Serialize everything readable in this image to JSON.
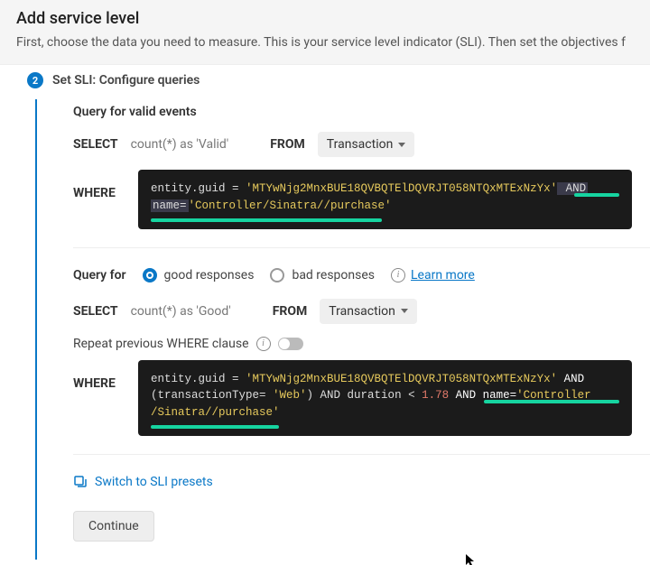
{
  "header": {
    "title": "Add service level",
    "description": "First, choose the data you need to measure. This is your service level indicator (SLI). Then set the objectives f"
  },
  "step": {
    "number": "2",
    "label": "Set SLI: Configure queries"
  },
  "valid": {
    "title": "Query for valid events",
    "select_kw": "SELECT",
    "select_expr": "count(*) as 'Valid'",
    "from_kw": "FROM",
    "source": "Transaction",
    "where_kw": "WHERE",
    "code": {
      "l1a": "entity.guid = ",
      "l1b": "'MTYwNjg2MnxBUE18QVBQTElDQVRJT058NTQxMTExNzYx'",
      "l1c": " AND ",
      "l2a": "name=",
      "l2b": "'Controller/Sinatra//purchase'"
    }
  },
  "good": {
    "title": "Query for",
    "radio_good": "good responses",
    "radio_bad": "bad responses",
    "learn_more": "Learn more",
    "select_kw": "SELECT",
    "select_expr": "count(*) as 'Good'",
    "from_kw": "FROM",
    "source": "Transaction",
    "repeat_label": "Repeat previous WHERE clause",
    "where_kw": "WHERE",
    "code": {
      "l1a": "entity.guid = ",
      "l1b": "'MTYwNjg2MnxBUE18QVBQTElDQVRJT058NTQxMTExNzYx'",
      "l1c": "  AND ",
      "l2a": "(transactionType= ",
      "l2b": "'Web'",
      "l2c": ") AND duration < ",
      "l2d": "1.78",
      "l2e": " AND name=",
      "l2f": "'Controller",
      "l3a": "/Sinatra//purchase'"
    }
  },
  "actions": {
    "preset_link": "Switch to SLI presets",
    "continue": "Continue"
  }
}
